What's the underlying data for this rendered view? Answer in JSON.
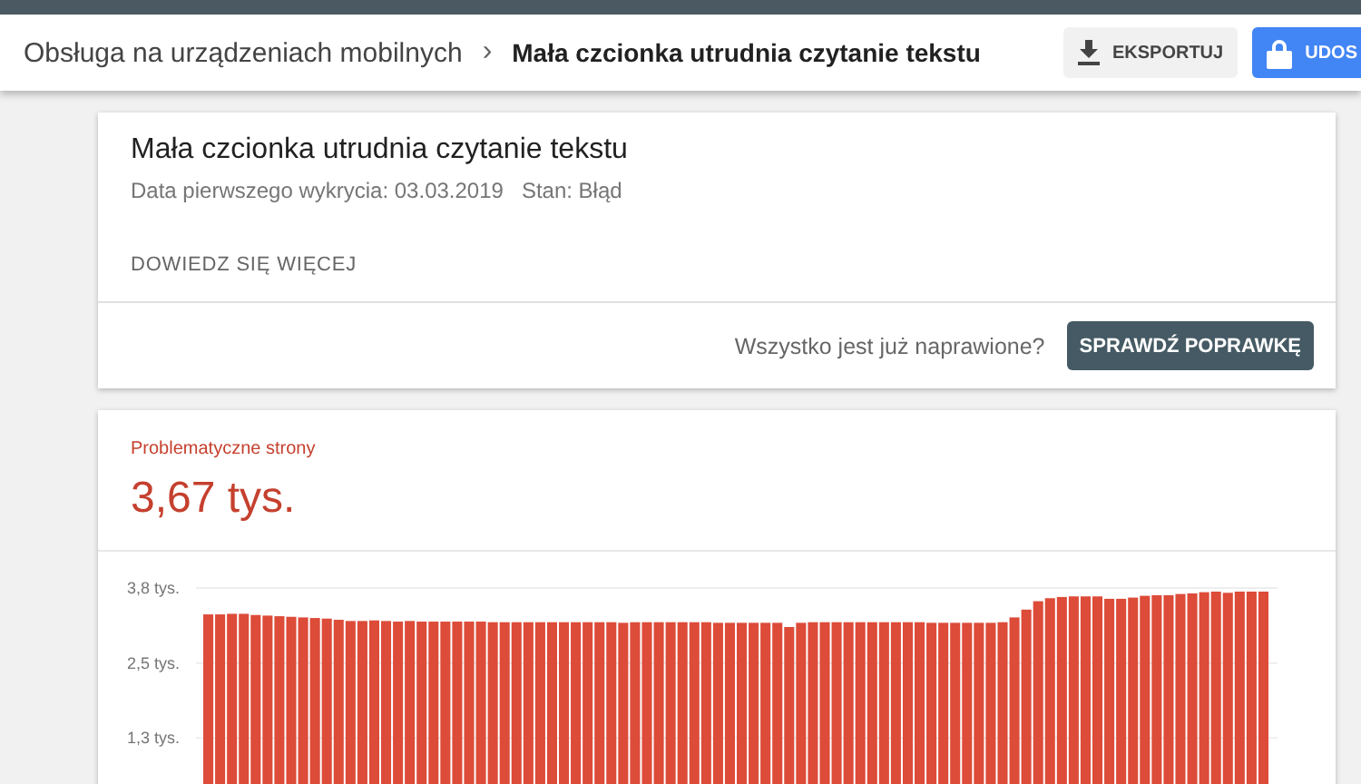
{
  "header": {
    "breadcrumb": [
      {
        "label": "Obsługa na urządzeniach mobilnych",
        "current": false
      },
      {
        "label": "Mała czcionka utrudnia czytanie tekstu",
        "current": true
      }
    ],
    "separator": "›",
    "buttons": [
      {
        "label": "EKSPORTUJ",
        "kind": "download"
      },
      {
        "label": "UDOS",
        "kind": "share"
      }
    ]
  },
  "issue": {
    "title": "Mała czcionka utrudnia czytanie tekstu",
    "detected": "Data pierwszego wykrycia: 03.03.2019",
    "status": "Stan: Błąd",
    "learn_more": "DOWIEDZ SIĘ WIĘCEJ",
    "question": "Wszystko jest już naprawione?",
    "validate_button": "SPRAWDŹ POPRAWKĘ"
  },
  "pages": {
    "label": "Problematyczne strony",
    "value": "3,67 tys.",
    "chart_data": {
      "type": "bar",
      "ylim": [
        0,
        3.75
      ],
      "yticks": [
        {
          "value": 3.75,
          "label": "3,8 tys."
        },
        {
          "value": 2.5,
          "label": "2,5 tys."
        },
        {
          "value": 1.25,
          "label": "1,3 tys."
        }
      ],
      "series": [
        {
          "color": "#dd4b39",
          "values": [
            3.31,
            3.31,
            3.32,
            3.32,
            3.3,
            3.29,
            3.28,
            3.27,
            3.26,
            3.25,
            3.24,
            3.22,
            3.2,
            3.2,
            3.21,
            3.2,
            3.19,
            3.2,
            3.19,
            3.19,
            3.19,
            3.19,
            3.19,
            3.19,
            3.18,
            3.18,
            3.18,
            3.18,
            3.18,
            3.18,
            3.18,
            3.18,
            3.18,
            3.18,
            3.18,
            3.17,
            3.18,
            3.18,
            3.18,
            3.18,
            3.18,
            3.18,
            3.18,
            3.17,
            3.17,
            3.17,
            3.17,
            3.17,
            3.17,
            3.1,
            3.17,
            3.18,
            3.18,
            3.18,
            3.18,
            3.18,
            3.18,
            3.18,
            3.18,
            3.18,
            3.18,
            3.17,
            3.17,
            3.17,
            3.17,
            3.17,
            3.17,
            3.18,
            3.26,
            3.39,
            3.53,
            3.58,
            3.6,
            3.61,
            3.61,
            3.61,
            3.57,
            3.57,
            3.59,
            3.62,
            3.63,
            3.63,
            3.65,
            3.66,
            3.68,
            3.69,
            3.67,
            3.69,
            3.69,
            3.69
          ]
        }
      ]
    }
  }
}
